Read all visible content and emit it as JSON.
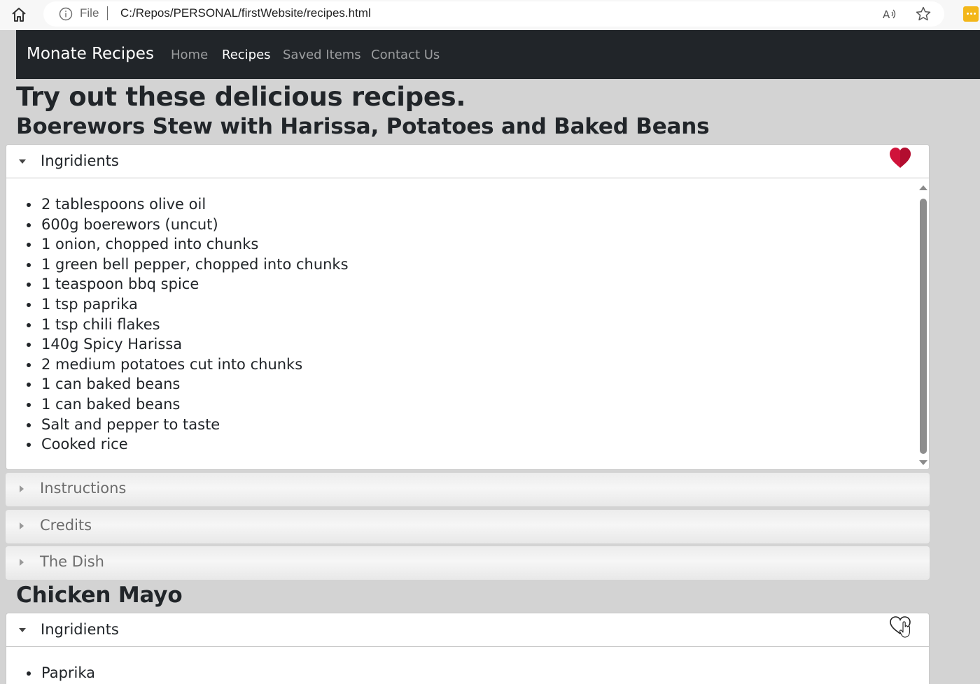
{
  "browser": {
    "file_label": "File",
    "url": "C:/Repos/PERSONAL/firstWebsite/recipes.html"
  },
  "navbar": {
    "brand": "Monate Recipes",
    "links": [
      "Home",
      "Recipes",
      "Saved Items",
      "Contact Us"
    ],
    "active": "Recipes"
  },
  "page": {
    "title": "Try out these delicious recipes."
  },
  "recipes": [
    {
      "name": "Boerewors Stew with Harissa, Potatoes and Baked Beans",
      "saved": true,
      "sections": {
        "ingredients": "Ingridients",
        "instructions": "Instructions",
        "credits": "Credits",
        "dish": "The Dish"
      },
      "ingredients": [
        "2 tablespoons olive oil",
        "600g boerewors (uncut)",
        "1 onion, chopped into chunks",
        "1 green bell pepper, chopped into chunks",
        "1 teaspoon bbq spice",
        "1 tsp paprika",
        "1 tsp chili flakes",
        "140g Spicy Harissa",
        "2 medium potatoes cut into chunks",
        "1 can baked beans",
        "1 can baked beans",
        "Salt and pepper to taste",
        "Cooked rice"
      ]
    },
    {
      "name": "Chicken Mayo",
      "saved": false,
      "sections": {
        "ingredients": "Ingridients"
      },
      "ingredients": [
        "Paprika"
      ]
    }
  ],
  "colors": {
    "page_bg": "#d3d3d3",
    "navbar_bg": "#212529",
    "heart_fill": "#d0133a"
  }
}
